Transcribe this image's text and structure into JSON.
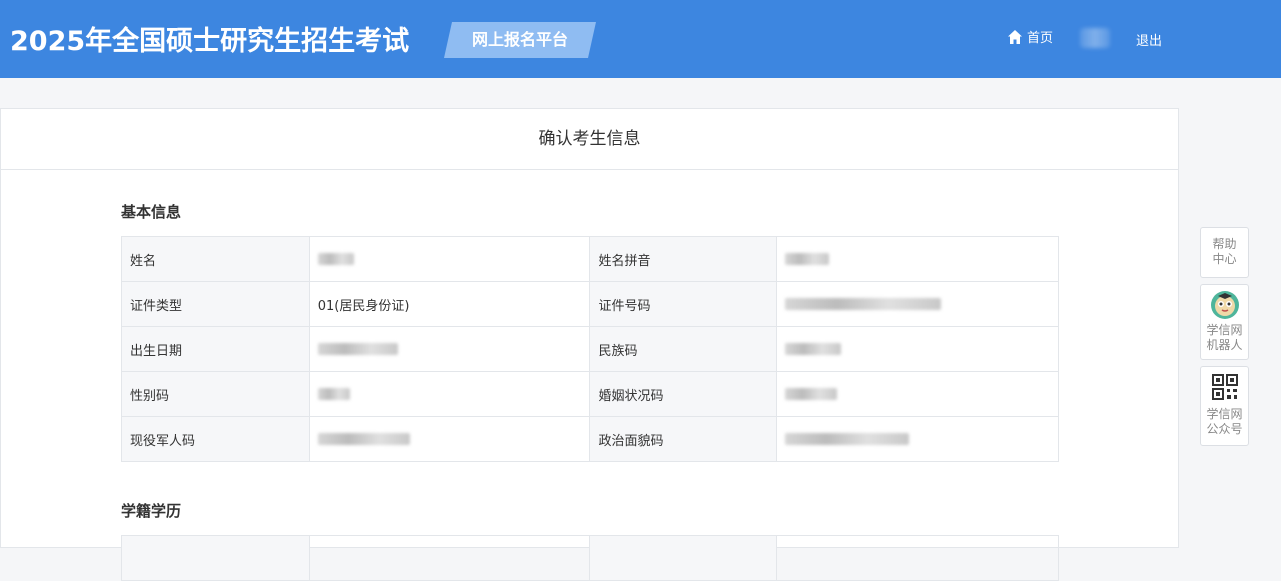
{
  "header": {
    "title": "2025年全国硕士研究生招生考试",
    "platform": "网上报名平台",
    "home_label": "首页",
    "logout_label": "退出"
  },
  "page": {
    "title": "确认考生信息"
  },
  "basic_info": {
    "section_title": "基本信息",
    "rows": [
      {
        "label1": "姓名",
        "value1": "",
        "label2": "姓名拼音",
        "value2": ""
      },
      {
        "label1": "证件类型",
        "value1": "01(居民身份证)",
        "label2": "证件号码",
        "value2": ""
      },
      {
        "label1": "出生日期",
        "value1": "",
        "label2": "民族码",
        "value2": ""
      },
      {
        "label1": "性别码",
        "value1": "",
        "label2": "婚姻状况码",
        "value2": ""
      },
      {
        "label1": "现役军人码",
        "value1": "",
        "label2": "政治面貌码",
        "value2": ""
      }
    ]
  },
  "education": {
    "section_title": "学籍学历"
  },
  "side_tools": {
    "help": "帮助中心",
    "robot": "学信网机器人",
    "official": "学信网公众号"
  }
}
